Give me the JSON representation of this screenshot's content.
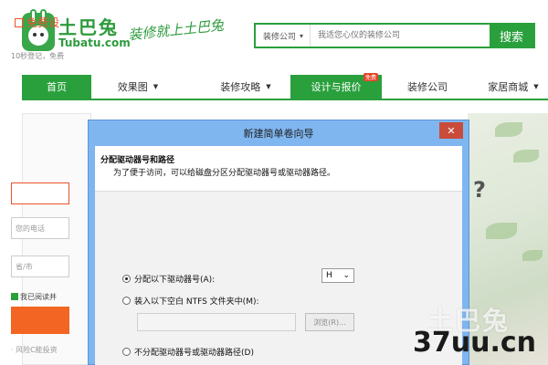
{
  "header": {
    "logo_name": "土巴兔",
    "logo_domain": "Tubatu.com",
    "slogan": "装修就上土巴兔",
    "search": {
      "category": "装修公司",
      "placeholder": "我适您心仪的装修公司",
      "button": "搜索"
    }
  },
  "nav": {
    "items": [
      {
        "label": "首页",
        "active": true,
        "dropdown": false
      },
      {
        "label": "效果图",
        "active": false,
        "dropdown": true
      },
      {
        "label": "装修攻略",
        "active": false,
        "dropdown": true
      },
      {
        "label": "设计与报价",
        "active": true,
        "dropdown": false,
        "badge": "免费"
      },
      {
        "label": "装修公司",
        "active": false,
        "dropdown": false
      },
      {
        "label": "家居商城",
        "active": false,
        "dropdown": true
      }
    ]
  },
  "left_form": {
    "title": "免费设",
    "tip": "10秒登记，免费",
    "fields": [
      "",
      "您的电话",
      "省/市"
    ],
    "agree": "我已阅读并",
    "risk": "· 风险C能投资"
  },
  "dialog": {
    "title": "新建简单卷向导",
    "close": "✕",
    "heading": "分配驱动器号和路径",
    "subheading": "为了便于访问，可以给磁盘分区分配驱动器号或驱动器路径。",
    "options": {
      "assign_letter": "分配以下驱动器号(A):",
      "mount_folder": "装入以下空白 NTFS 文件夹中(M):",
      "no_assign": "不分配驱动器号或驱动器路径(D)"
    },
    "drive_letter": "H",
    "browse": "浏览(R)...",
    "selected_option": "assign_letter"
  },
  "watermark": {
    "ghost": "土巴兔",
    "site": "37uu.cn"
  },
  "colors": {
    "brand_green": "#2aa03d",
    "accent_orange": "#f26522",
    "dialog_frame": "#7fb6f0",
    "close_red": "#c94c3a"
  }
}
